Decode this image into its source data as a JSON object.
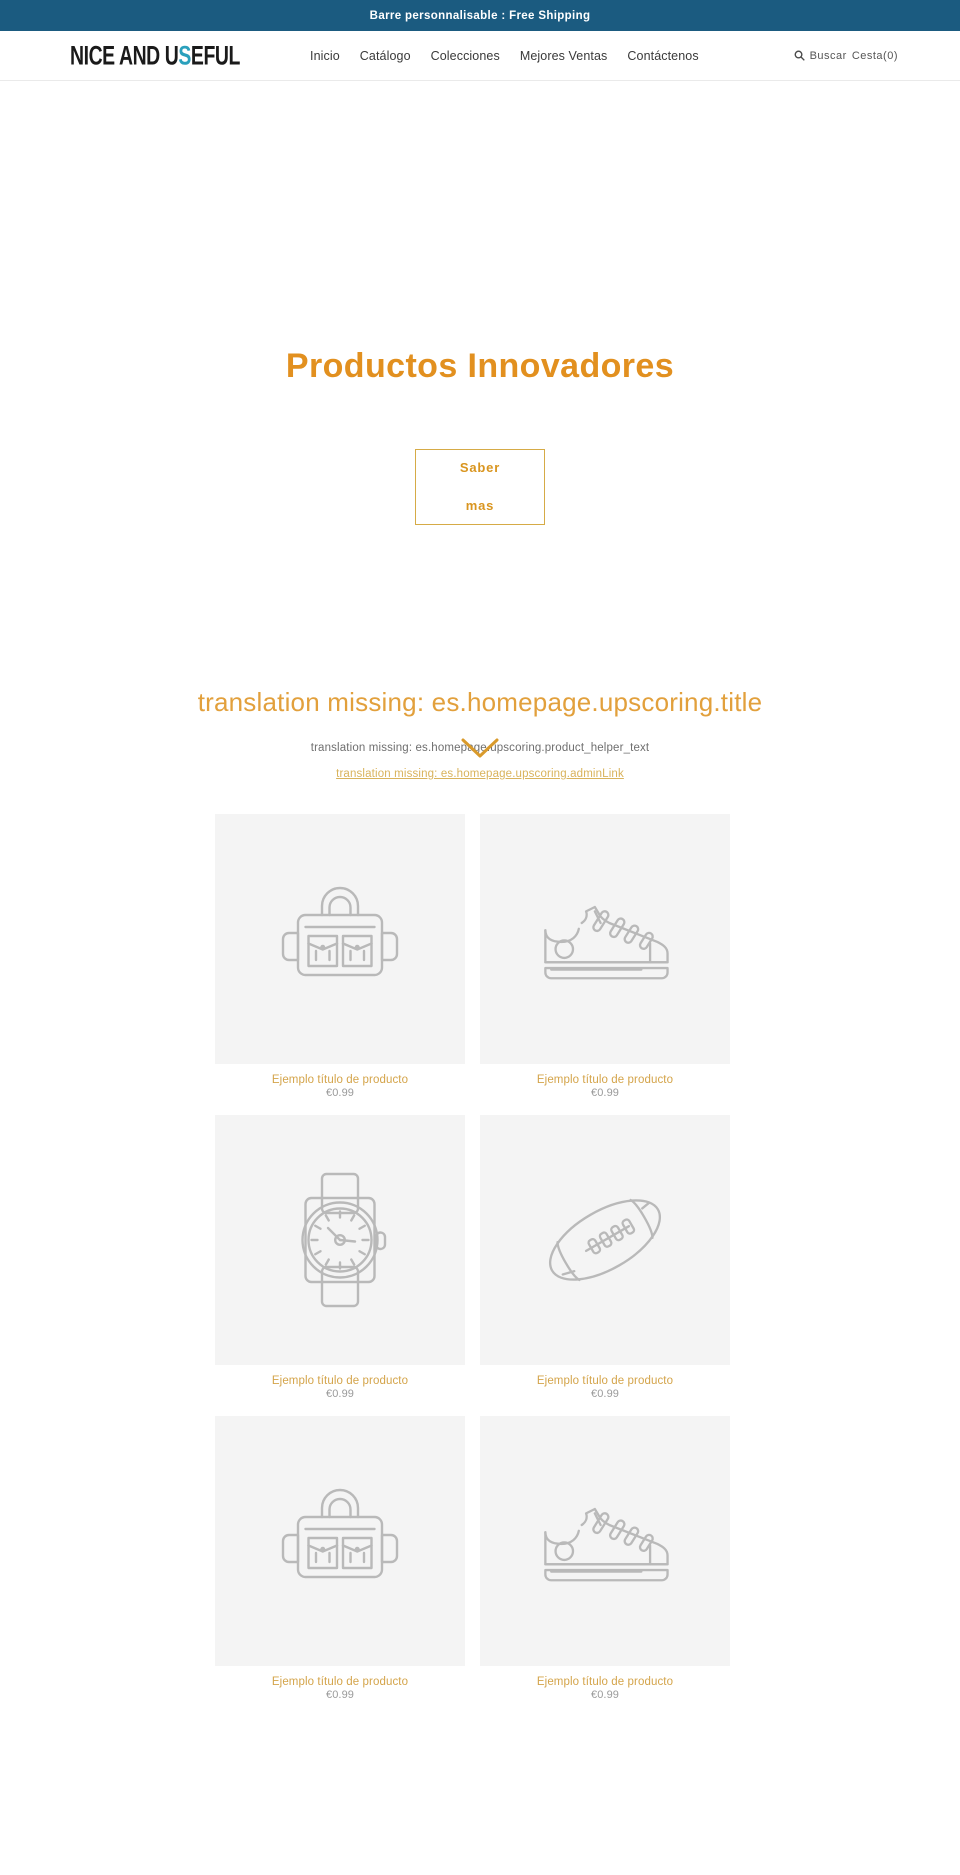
{
  "announcement": {
    "text": "Barre personnalisable : Free Shipping",
    "background": "#1b5b80"
  },
  "header": {
    "logo": {
      "part1": "NICE AND U",
      "accent": "S",
      "part2": "EFUL",
      "accent_color": "#2aa0bc"
    },
    "nav": [
      {
        "label": "Inicio"
      },
      {
        "label": "Catálogo"
      },
      {
        "label": "Colecciones"
      },
      {
        "label": "Mejores Ventas"
      },
      {
        "label": "Contáctenos"
      }
    ],
    "utils": {
      "search_icon": "search-icon",
      "search_label": "Buscar",
      "cart_label": "Cesta(0)"
    }
  },
  "hero": {
    "title": "Productos Innovadores",
    "title_color": "#e2901f",
    "button_line1": "Saber",
    "button_line2": "mas",
    "button_border_color": "#d6ab46",
    "scroll_icon": "chevron-down-icon"
  },
  "upscoring": {
    "title": "translation missing: es.homepage.upscoring.title",
    "helper_text": "translation missing: es.homepage.upscoring.product_helper_text",
    "admin_link": "translation missing: es.homepage.upscoring.adminLink",
    "title_color": "#e2a03c"
  },
  "products": [
    {
      "icon": "backpack-icon",
      "title": "Ejemplo título de producto",
      "price": "€0.99"
    },
    {
      "icon": "sneaker-icon",
      "title": "Ejemplo título de producto",
      "price": "€0.99"
    },
    {
      "icon": "watch-icon",
      "title": "Ejemplo título de producto",
      "price": "€0.99"
    },
    {
      "icon": "football-icon",
      "title": "Ejemplo título de producto",
      "price": "€0.99"
    },
    {
      "icon": "backpack-icon",
      "title": "Ejemplo título de producto",
      "price": "€0.99"
    },
    {
      "icon": "sneaker-icon",
      "title": "Ejemplo título de producto",
      "price": "€0.99"
    }
  ]
}
